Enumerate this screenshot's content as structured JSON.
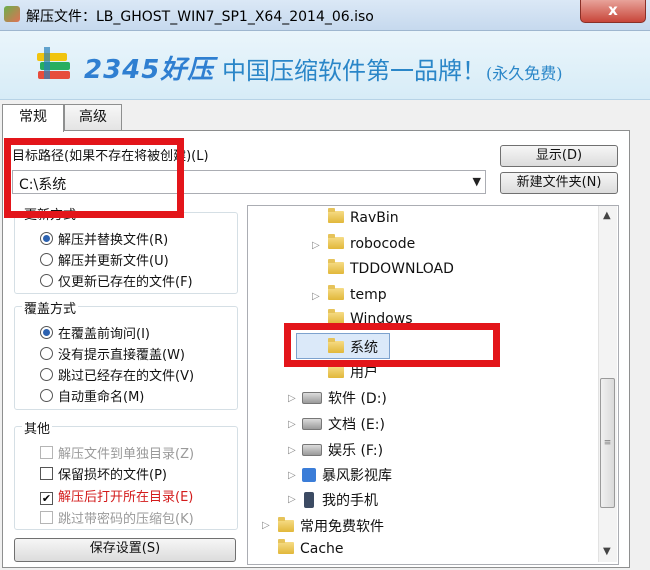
{
  "window": {
    "title": "解压文件：LB_GHOST_WIN7_SP1_X64_2014_06.iso",
    "close_label": "x"
  },
  "banner": {
    "logo_text": "2345好压",
    "slogan": "中国压缩软件第一品牌！",
    "slogan_small": "(永久免费)"
  },
  "tabs": [
    {
      "label": "常规"
    },
    {
      "label": "高级"
    }
  ],
  "path": {
    "label": "目标路径(如果不存在将被创建)(L)",
    "value": "C:\\系统",
    "show_button": "显示(D)",
    "new_folder_button": "新建文件夹(N)"
  },
  "update_mode": {
    "title": "更新方式",
    "options": [
      {
        "label": "解压并替换文件(R)",
        "selected": true
      },
      {
        "label": "解压并更新文件(U)",
        "selected": false
      },
      {
        "label": "仅更新已存在的文件(F)",
        "selected": false
      }
    ]
  },
  "overwrite_mode": {
    "title": "覆盖方式",
    "options": [
      {
        "label": "在覆盖前询问(I)",
        "selected": true
      },
      {
        "label": "没有提示直接覆盖(W)",
        "selected": false
      },
      {
        "label": "跳过已经存在的文件(V)",
        "selected": false
      },
      {
        "label": "自动重命名(M)",
        "selected": false
      }
    ]
  },
  "other": {
    "title": "其他",
    "options": [
      {
        "label": "解压文件到单独目录(Z)",
        "checked": false,
        "disabled": true
      },
      {
        "label": "保留损坏的文件(P)",
        "checked": false,
        "disabled": false
      },
      {
        "label": "解压后打开所在目录(E)",
        "checked": true,
        "disabled": false
      },
      {
        "label": "跳过带密码的压缩包(K)",
        "checked": false,
        "disabled": true
      }
    ]
  },
  "save_button": "保存设置(S)",
  "tree": {
    "items": [
      {
        "label": "RavBin",
        "icon": "folder"
      },
      {
        "label": "robocode",
        "icon": "folder"
      },
      {
        "label": "TDDOWNLOAD",
        "icon": "folder"
      },
      {
        "label": "temp",
        "icon": "folder"
      },
      {
        "label": "Windows",
        "icon": "folder"
      },
      {
        "label": "系统",
        "icon": "folder",
        "selected": true
      },
      {
        "label": "用户",
        "icon": "folder"
      },
      {
        "label": "软件 (D:)",
        "icon": "drive"
      },
      {
        "label": "文档 (E:)",
        "icon": "drive"
      },
      {
        "label": "娱乐 (F:)",
        "icon": "drive"
      },
      {
        "label": "暴风影视库",
        "icon": "app"
      },
      {
        "label": "我的手机",
        "icon": "phone"
      },
      {
        "label": "常用免费软件",
        "icon": "folder"
      },
      {
        "label": "Cache",
        "icon": "folder"
      }
    ]
  },
  "colors": {
    "highlight_red": "#e3151a",
    "selection_blue": "#dbe9f9"
  }
}
